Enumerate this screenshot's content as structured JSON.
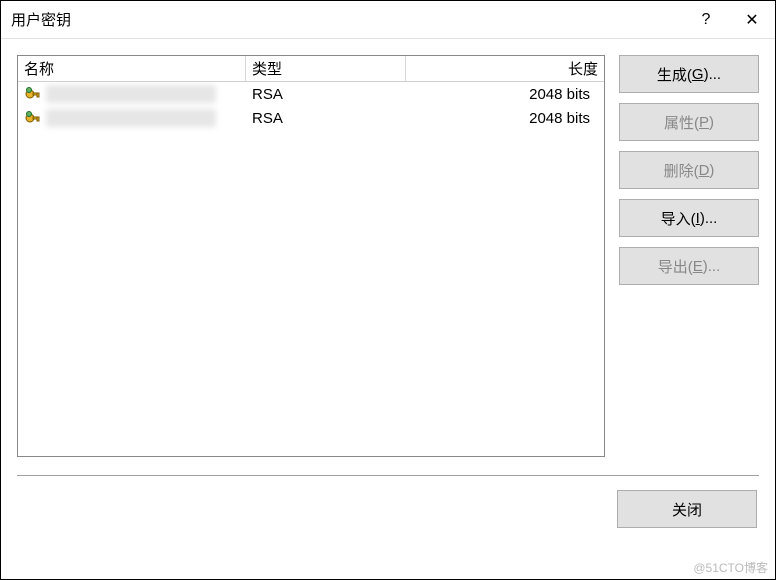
{
  "titlebar": {
    "title": "用户密钥",
    "help": "?",
    "close": "✕"
  },
  "columns": {
    "name": "名称",
    "type": "类型",
    "length": "长度"
  },
  "rows": [
    {
      "type": "RSA",
      "length": "2048 bits"
    },
    {
      "type": "RSA",
      "length": "2048 bits"
    }
  ],
  "buttons": {
    "generate_pre": "生成(",
    "generate_key": "G",
    "generate_post": ")...",
    "props_pre": "属性(",
    "props_key": "P",
    "props_post": ")",
    "delete_pre": "删除(",
    "delete_key": "D",
    "delete_post": ")",
    "import_pre": "导入(",
    "import_key": "I",
    "import_post": ")...",
    "export_pre": "导出(",
    "export_key": "E",
    "export_post": ")...",
    "close": "关闭"
  },
  "watermark": "@51CTO博客"
}
